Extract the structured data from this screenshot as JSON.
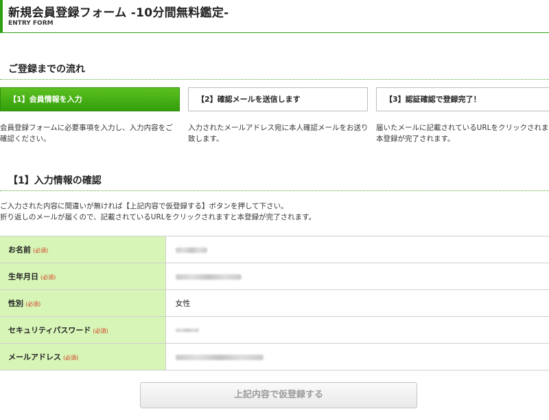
{
  "header": {
    "title": "新規会員登録フォーム -10分間無料鑑定-",
    "subtitle": "ENTRY FORM"
  },
  "flow": {
    "heading": "ご登録までの流れ",
    "steps": [
      {
        "label": "【1】会員情報を入力",
        "active": true,
        "desc": [
          "会員登録フォームに必要事項を入力し、入力内容をご",
          "確認ください。"
        ]
      },
      {
        "label": "【2】確認メールを送信します",
        "active": false,
        "desc": [
          "入力されたメールアドレス宛に本人確認メールをお送り",
          "致します。"
        ]
      },
      {
        "label": "【3】認証確認で登録完了！",
        "active": false,
        "desc": [
          "届いたメールに記載されているURLをクリックされますと",
          "本登録が完了されます。"
        ]
      }
    ]
  },
  "confirm": {
    "heading": "【1】入力情報の確認",
    "intro": [
      "ご入力された内容に間違いが無ければ【上記内容で仮登録する】ボタンを押して下さい。",
      "折り返しのメールが届くので、記載されているURLをクリックされますと本登録が完了されます。"
    ],
    "required_label": "(必須)",
    "rows": [
      {
        "label": "お名前",
        "value": ""
      },
      {
        "label": "生年月日",
        "value": ""
      },
      {
        "label": "性別",
        "value": "女性"
      },
      {
        "label": "セキュリティパスワード",
        "value": ""
      },
      {
        "label": "メールアドレス",
        "value": ""
      }
    ]
  },
  "submit": {
    "label": "上記内容で仮登録する"
  },
  "colors": {
    "accent": "#2e9e12",
    "label_bg": "#d8f5b8",
    "required": "#d03a1c"
  }
}
